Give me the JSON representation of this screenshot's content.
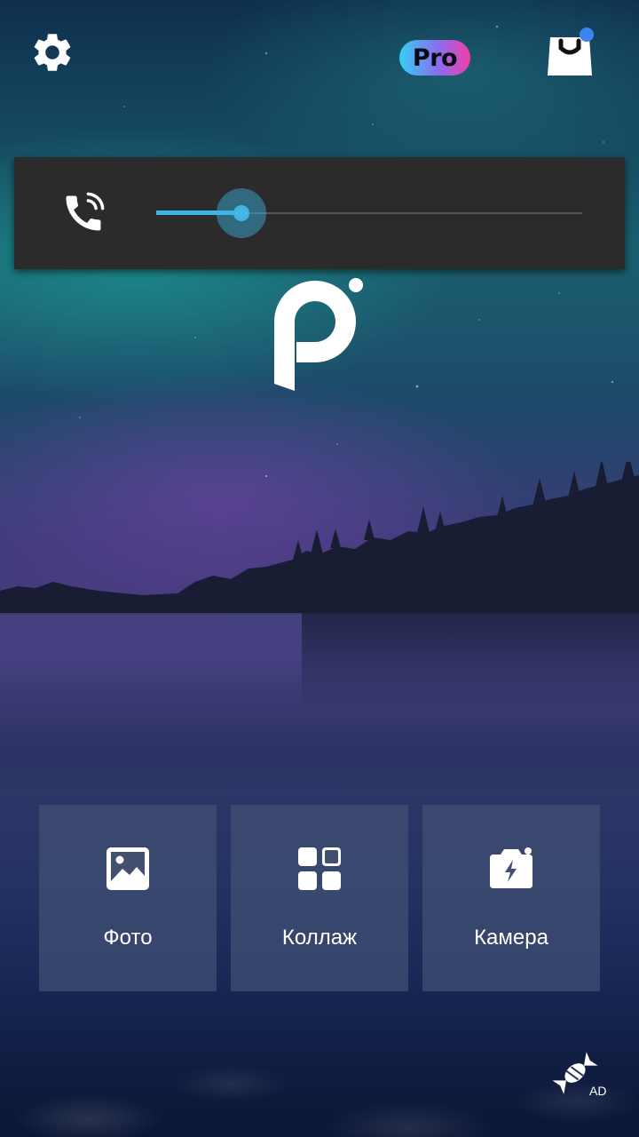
{
  "header": {
    "settings_icon": "gear-icon",
    "pro_label": "Pro",
    "shop_icon": "shopping-bag-icon",
    "shop_notification_color": "#3a86f0"
  },
  "volume_panel": {
    "icon": "phone-in-call-icon",
    "level": 0.2,
    "accent_color": "#3fb6e6"
  },
  "logo": {
    "icon": "picsart-logo"
  },
  "actions": [
    {
      "label": "Фото",
      "icon": "image-icon"
    },
    {
      "label": "Коллаж",
      "icon": "grid-icon"
    },
    {
      "label": "Камера",
      "icon": "camera-icon"
    }
  ],
  "ad": {
    "icon": "candy-icon",
    "label": "AD"
  }
}
